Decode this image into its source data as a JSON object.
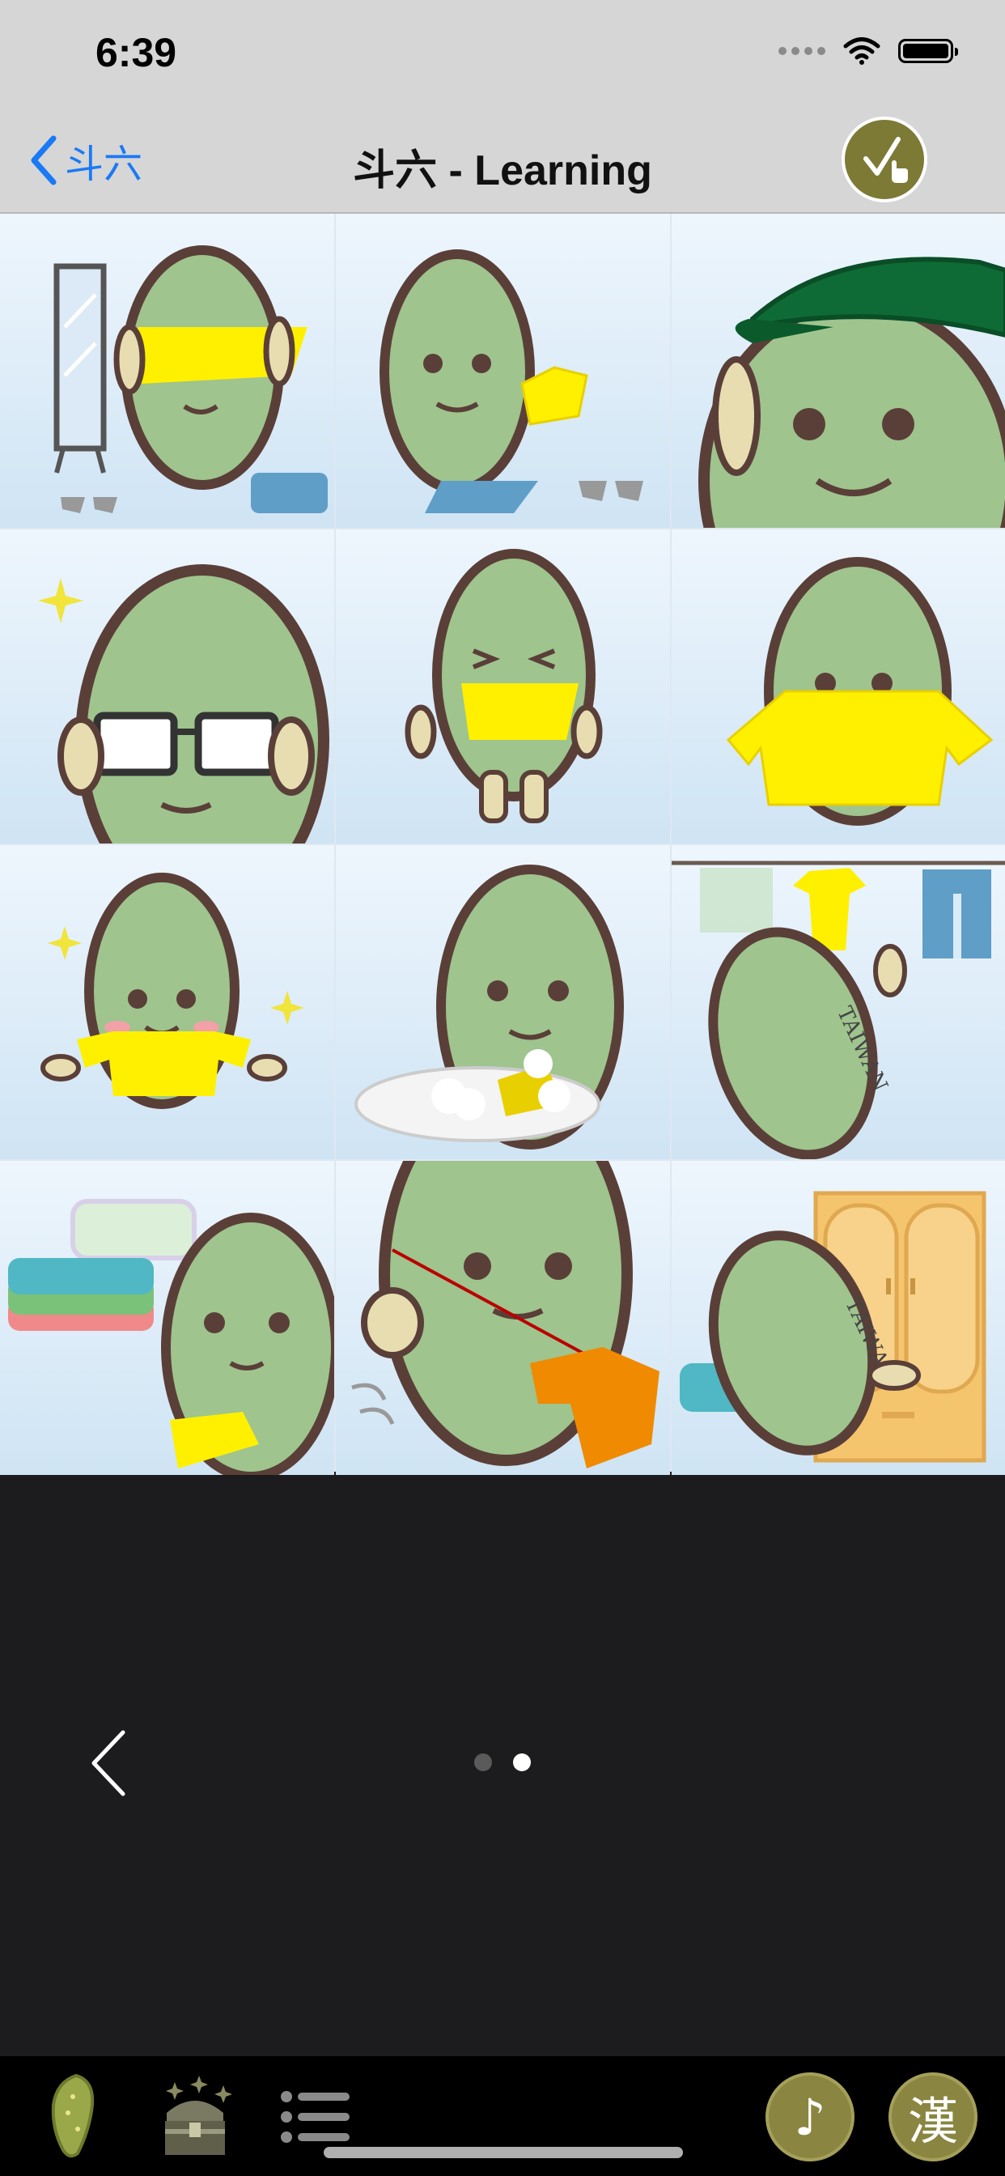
{
  "status": {
    "time": "6:39"
  },
  "nav": {
    "back_label": "斗六",
    "title": "斗六 - Learning"
  },
  "grid": {
    "tiles": [
      {
        "icon": "dressing-mirror-shirt-icon"
      },
      {
        "icon": "removing-clothes-icon"
      },
      {
        "icon": "green-cap-icon"
      },
      {
        "icon": "glasses-icon"
      },
      {
        "icon": "pulling-shirt-icon"
      },
      {
        "icon": "yellow-shirt-icon"
      },
      {
        "icon": "shirt-on-icon"
      },
      {
        "icon": "washing-clothes-icon"
      },
      {
        "icon": "hanging-laundry-icon"
      },
      {
        "icon": "folded-clothes-icon"
      },
      {
        "icon": "sewing-icon"
      },
      {
        "icon": "wardrobe-icon"
      }
    ],
    "tile_labels": {
      "laundry": "TAIWAN",
      "wardrobe": "TAIWAN"
    }
  },
  "pager": {
    "total_pages": 2,
    "current_page": 2
  },
  "tab_bar": {
    "music_label": "♪",
    "chinese_label": "漢",
    "icons": [
      "taiwan-map-icon",
      "treasure-chest-icon",
      "list-icon"
    ]
  },
  "colors": {
    "accent": "#1a7af5",
    "olive": "#7d7a36",
    "character": "#9fc48e",
    "outline": "#5a3f38",
    "yellow": "#fff000"
  }
}
